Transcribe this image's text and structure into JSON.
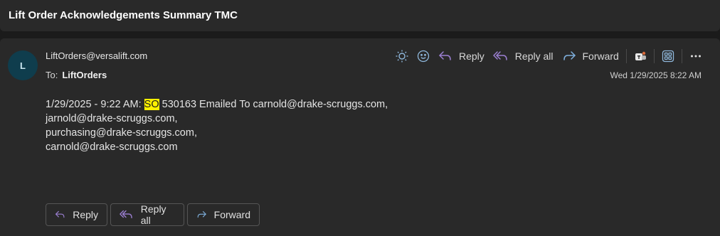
{
  "subject": "Lift Order Acknowledgements Summary TMC",
  "message": {
    "avatar_initial": "L",
    "sender": "LiftOrders@versalift.com",
    "to_label": "To:",
    "to_name": "LiftOrders",
    "date": "Wed 1/29/2025 8:22 AM",
    "body": {
      "line1_prefix": "1/29/2025 - 9:22 AM: ",
      "line1_highlight": "SO",
      "line1_suffix": " 530163 Emailed To carnold@drake-scruggs.com,",
      "line2": "jarnold@drake-scruggs.com,",
      "line3": "purchasing@drake-scruggs.com,",
      "line4": "carnold@drake-scruggs.com"
    }
  },
  "toolbar": {
    "brightness_icon": "sun-icon",
    "emoji_icon": "smiley-icon",
    "reply_label": "Reply",
    "reply_all_label": "Reply all",
    "forward_label": "Forward",
    "teams_icon": "teams-icon",
    "apps_icon": "apps-grid-icon",
    "more_icon": "more-icon"
  },
  "actions": {
    "reply_label": "Reply",
    "reply_all_label": "Reply all",
    "forward_label": "Forward"
  },
  "colors": {
    "background": "#1b1b1b",
    "card": "#292929",
    "accent_icon": "#9b7fd1",
    "forward_icon": "#7fb0de",
    "highlight": "#fff100"
  }
}
